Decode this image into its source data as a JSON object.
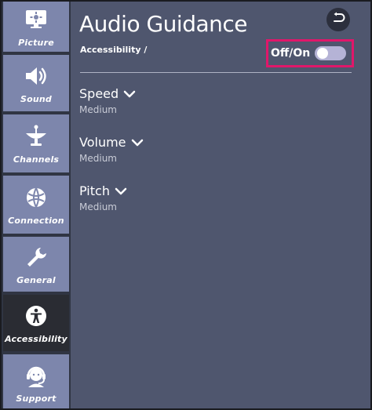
{
  "sidebar": {
    "items": [
      {
        "label": "Picture",
        "icon": "monitor-icon"
      },
      {
        "label": "Sound",
        "icon": "speaker-icon"
      },
      {
        "label": "Channels",
        "icon": "satellite-dish-icon"
      },
      {
        "label": "Connection",
        "icon": "globe-icon"
      },
      {
        "label": "General",
        "icon": "wrench-icon"
      },
      {
        "label": "Accessibility",
        "icon": "accessibility-icon",
        "active": true
      },
      {
        "label": "Support",
        "icon": "support-agent-icon"
      }
    ]
  },
  "main": {
    "title": "Audio Guidance",
    "breadcrumb": "Accessibility /",
    "toggle": {
      "label": "Off/On",
      "state": "off"
    },
    "settings": [
      {
        "name": "Speed",
        "value": "Medium"
      },
      {
        "name": "Volume",
        "value": "Medium"
      },
      {
        "name": "Pitch",
        "value": "Medium"
      }
    ]
  },
  "colors": {
    "panel": "#4f566e",
    "sidebar_item": "#7d86ac",
    "sidebar_active": "#2a2c33",
    "highlight": "#e0176a"
  }
}
